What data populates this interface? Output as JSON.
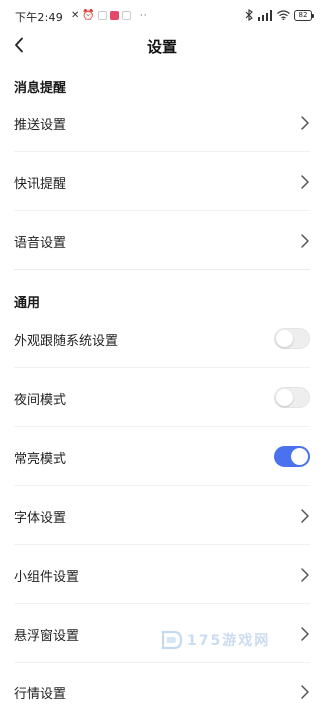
{
  "status_bar": {
    "time": "下午2:49",
    "left_icons": [
      "mute-icon",
      "alarm-icon",
      "app-icon-white",
      "app-icon-pink",
      "app-icon-white"
    ],
    "overflow_dots": "··",
    "right_icons": [
      "bluetooth-icon",
      "signal-icon",
      "wifi-icon"
    ],
    "battery": "82"
  },
  "header": {
    "title": "设置",
    "back_icon": "chevron-left-icon"
  },
  "sections": {
    "notifications": {
      "title": "消息提醒",
      "items": [
        {
          "label": "推送设置",
          "type": "link"
        },
        {
          "label": "快讯提醒",
          "type": "link"
        },
        {
          "label": "语音设置",
          "type": "link"
        }
      ]
    },
    "general": {
      "title": "通用",
      "items": [
        {
          "label": "外观跟随系统设置",
          "type": "toggle",
          "on": false
        },
        {
          "label": "夜间模式",
          "type": "toggle",
          "on": false
        },
        {
          "label": "常亮模式",
          "type": "toggle",
          "on": true
        },
        {
          "label": "字体设置",
          "type": "link"
        },
        {
          "label": "小组件设置",
          "type": "link"
        },
        {
          "label": "悬浮窗设置",
          "type": "link"
        },
        {
          "label": "行情设置",
          "type": "link"
        }
      ]
    }
  },
  "watermark": {
    "text": "175游戏网"
  },
  "colors": {
    "accent": "#4a72ee",
    "toggle_off": "#eeeeee",
    "chevron": "#555555",
    "divider": "#f1f1f1"
  }
}
